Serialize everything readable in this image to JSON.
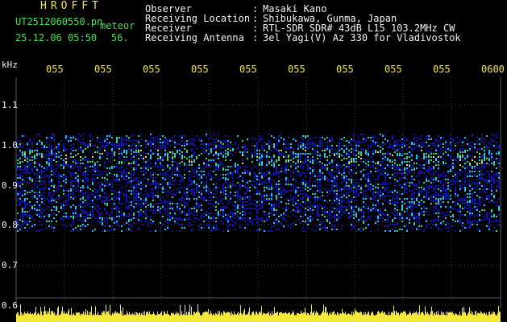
{
  "header": {
    "brand": "HROFFT",
    "filename": "UT2512060550.pn",
    "meteor_label": "meteor",
    "datetime": "25.12.06 05:50",
    "count": "56."
  },
  "info": [
    {
      "label": "Observer",
      "value": "Masaki Kano"
    },
    {
      "label": "Receiving Location",
      "value": "Shibukawa, Gunma, Japan"
    },
    {
      "label": "Receiver",
      "value": "RTL-SDR SDR# 43dB L15 103.2MHz CW"
    },
    {
      "label": "Receiving Antenna",
      "value": "3el Yagi(V) Az 330 for Vladivostok"
    }
  ],
  "colon": ":",
  "chart_data": {
    "type": "heatmap",
    "yunit": "kHz",
    "ylim": [
      0.6,
      1.15
    ],
    "yticks": [
      "1.1",
      "1.0",
      "0.9",
      "0.8",
      "0.7",
      "0.6"
    ],
    "xticks": [
      "055",
      "055",
      "055",
      "055",
      "055",
      "055",
      "055",
      "055",
      "055",
      "0600"
    ],
    "noise_band": [
      0.8,
      1.0
    ],
    "intense_line": 0.97,
    "colors": {
      "background": "#000000",
      "low": "#1010c8",
      "mid": "#1ec8e6",
      "high": "#30e060",
      "peak": "#f0e040",
      "grid": "#3a3a3a",
      "amplitude": "#f2e93a"
    }
  }
}
